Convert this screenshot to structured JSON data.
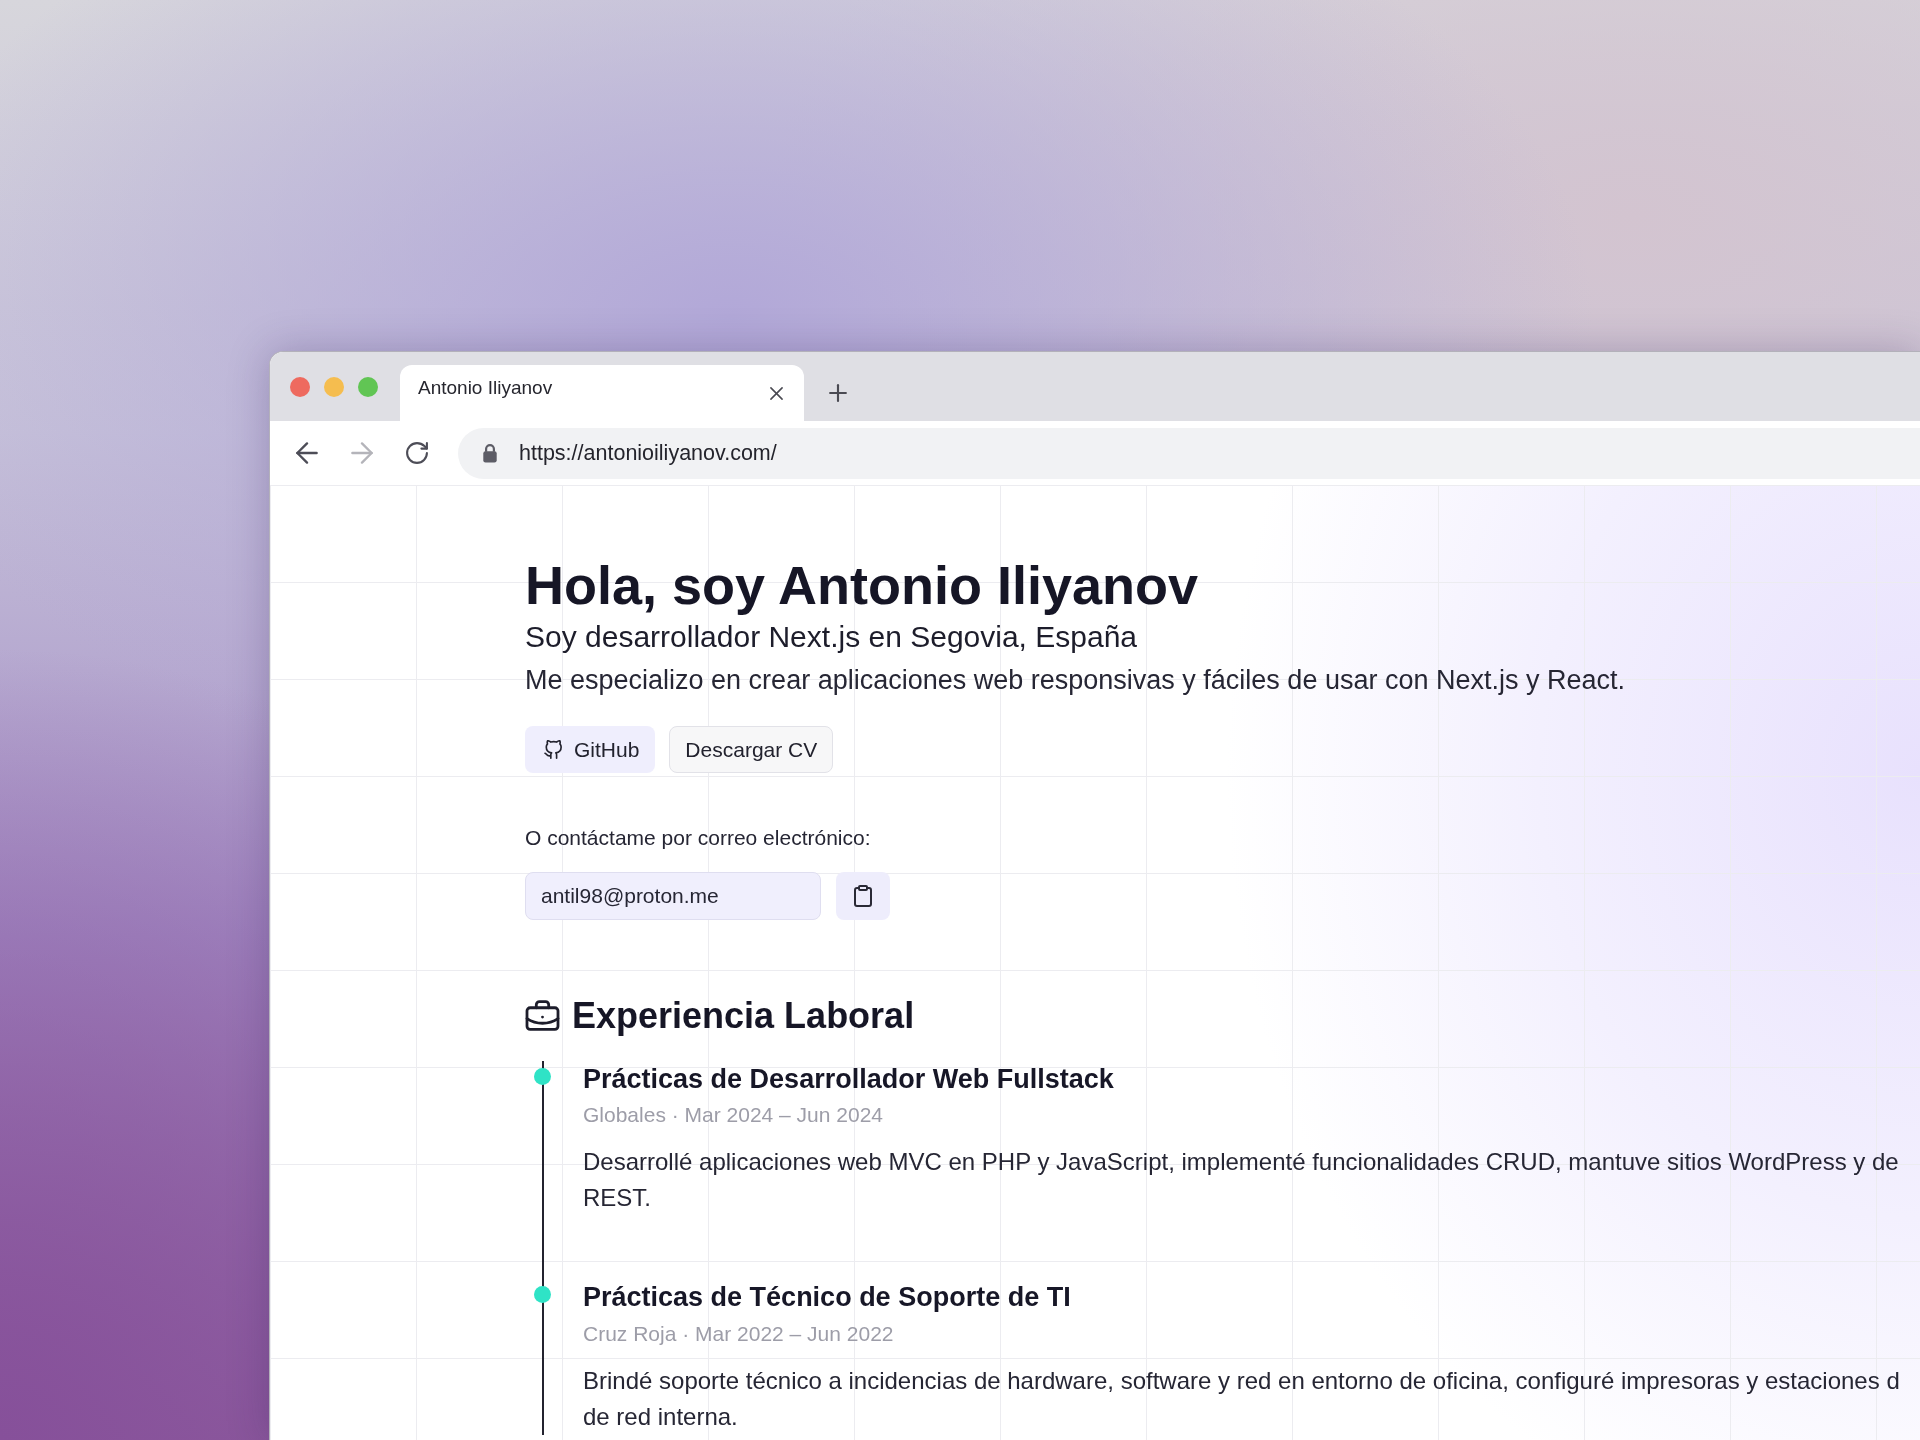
{
  "window": {
    "controls": [
      {
        "color": "#ee6a5f"
      },
      {
        "color": "#f5bd4f"
      },
      {
        "color": "#61c554"
      }
    ]
  },
  "tabs": [
    {
      "title": "Antonio Iliyanov",
      "selected": true
    }
  ],
  "toolbar": {
    "buttons": [
      {
        "kind": "back",
        "disabled": false
      },
      {
        "kind": "forward",
        "disabled": true
      },
      {
        "kind": "reload",
        "disabled": false
      }
    ],
    "address": "https://antonioiliyanov.com/"
  },
  "hero": {
    "title": "Hola, soy Antonio Iliyanov",
    "subtitle": "Soy desarrollador Next.js en Segovia, España",
    "description": "Me especializo en crear aplicaciones web responsivas y fáciles de usar con Next.js y React.",
    "buttons": [
      {
        "kind": "github",
        "label": "GitHub"
      },
      {
        "kind": "download",
        "label": "Descargar CV"
      }
    ],
    "contact_label": "O contáctame por correo electrónico:",
    "email": "antil98@proton.me"
  },
  "experience": {
    "title": "Experiencia Laboral",
    "items": [
      {
        "title": "Prácticas de Desarrollador Web Fullstack",
        "meta": "Globales · Mar 2024 – Jun 2024",
        "description": "Desarrollé aplicaciones web MVC en PHP y JavaScript, implementé funcionalidades CRUD, mantuve sitios WordPress y de\nREST."
      },
      {
        "title": "Prácticas de Técnico de Soporte de TI",
        "meta": "Cruz Roja · Mar 2022 – Jun 2022",
        "description": "Brindé soporte técnico a incidencias de hardware, software y red en entorno de oficina, configuré impresoras y estaciones d\nde red interna."
      }
    ]
  }
}
